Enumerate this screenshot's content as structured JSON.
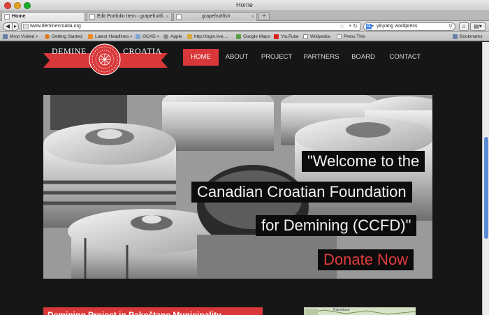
{
  "window": {
    "title": "Home"
  },
  "tabs": [
    {
      "label": "Home",
      "active": true
    },
    {
      "label": "Edit Portfolio Item ‹ grapefruitfi...",
      "active": false
    },
    {
      "label": "grapefruitfish",
      "active": false
    }
  ],
  "newtab_label": "+",
  "navbar": {
    "url": "www.deminecroatia.org",
    "search_value": "yinyang wordpress",
    "search_engine_icon": "google-icon"
  },
  "bookmarks": [
    {
      "label": "Most Visited",
      "icon": "bookmarks-icon",
      "has_menu": true
    },
    {
      "label": "Getting Started",
      "icon": "firefox-icon"
    },
    {
      "label": "Latest Headlines",
      "icon": "rss-icon",
      "has_menu": true
    },
    {
      "label": "OCAD",
      "icon": "folder-icon",
      "has_menu": true
    },
    {
      "label": "Apple",
      "icon": "apple-icon"
    },
    {
      "label": "http://login.live....",
      "icon": "live-icon"
    },
    {
      "label": "Google Maps",
      "icon": "maps-icon"
    },
    {
      "label": "YouTube",
      "icon": "youtube-icon"
    },
    {
      "label": "Wikipedia",
      "icon": "wikipedia-icon"
    },
    {
      "label": "Press This",
      "icon": "page-icon"
    }
  ],
  "bookmarks_menu": "Bookmarks",
  "site": {
    "logo": {
      "left": "DEMINE",
      "right": "CROATIA"
    },
    "nav": [
      {
        "label": "HOME",
        "active": true
      },
      {
        "label": "ABOUT",
        "active": false
      },
      {
        "label": "PROJECT",
        "active": false
      },
      {
        "label": "PARTNERS",
        "active": false
      },
      {
        "label": "BOARD",
        "active": false
      },
      {
        "label": "CONTACT",
        "active": false
      }
    ],
    "hero": {
      "line1": "\"Welcome to the",
      "line2": "Canadian Croatian Foundation",
      "line3": "for Demining (CCFD)\"",
      "cta": "Donate Now"
    },
    "section_title": "Demining Project in Pakoštane Municipality",
    "map_label": "Pakoštane"
  },
  "colors": {
    "accent": "#d9383a",
    "background": "#161616"
  }
}
